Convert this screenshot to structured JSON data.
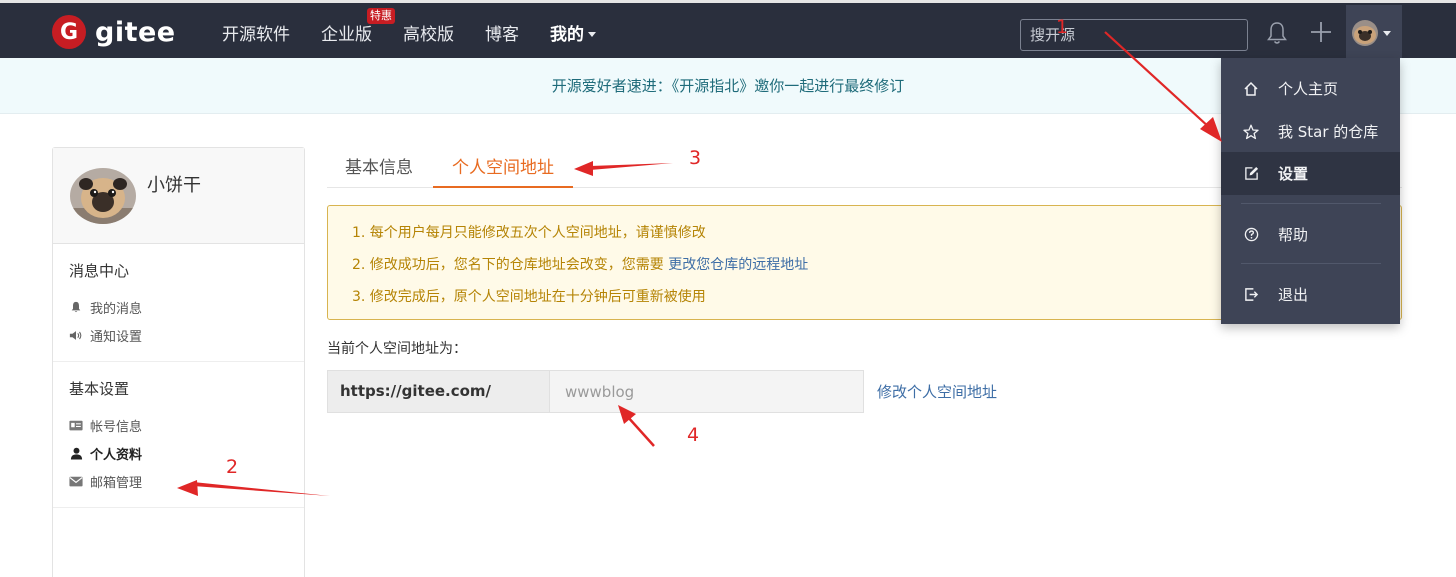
{
  "topbar": {
    "logo_letter": "G",
    "logo_text": "gitee",
    "nav": [
      {
        "label": "开源软件"
      },
      {
        "label": "企业版",
        "badge": "特惠"
      },
      {
        "label": "高校版"
      },
      {
        "label": "博客"
      },
      {
        "label": "我的"
      }
    ],
    "search_placeholder": "搜开源"
  },
  "announcement": "开源爱好者速进：《开源指北》邀你一起进行最终修订",
  "sidebar": {
    "profile_name": "小饼干",
    "groups": [
      {
        "title": "消息中心",
        "items": [
          {
            "label": "我的消息",
            "icon": "bell-icon"
          },
          {
            "label": "通知设置",
            "icon": "volume-icon"
          }
        ]
      },
      {
        "title": "基本设置",
        "items": [
          {
            "label": "帐号信息",
            "icon": "id-card-icon"
          },
          {
            "label": "个人资料",
            "icon": "user-icon",
            "active": true
          },
          {
            "label": "邮箱管理",
            "icon": "mail-icon"
          }
        ]
      }
    ]
  },
  "tabs": [
    {
      "label": "基本信息"
    },
    {
      "label": "个人空间地址",
      "active": true
    }
  ],
  "warning": {
    "line1": "1. 每个用户每月只能修改五次个人空间地址，请谨慎修改",
    "line2_prefix": "2. 修改成功后，您名下的仓库地址会改变，您需要 ",
    "line2_link": "更改您仓库的远程地址",
    "line3": "3. 修改完成后，原个人空间地址在十分钟后可重新被使用"
  },
  "address": {
    "label": "当前个人空间地址为：",
    "prefix": "https://gitee.com/",
    "value_placeholder": "wwwblog",
    "edit_link": "修改个人空间地址"
  },
  "dropdown": {
    "items": [
      {
        "label": "个人主页",
        "icon": "home-icon"
      },
      {
        "label": "我 Star 的仓库",
        "icon": "star-icon"
      },
      {
        "label": "设置",
        "icon": "edit-icon",
        "active": true
      },
      {
        "label": "帮助",
        "icon": "help-icon"
      },
      {
        "label": "退出",
        "icon": "logout-icon"
      }
    ]
  },
  "annotations": [
    "1",
    "2",
    "3",
    "4"
  ],
  "colors": {
    "brand": "#c71d23",
    "topbar": "#2a2f3d",
    "active_tab": "#e86b21",
    "link": "#3e6ea6",
    "annotation": "#e02727"
  }
}
